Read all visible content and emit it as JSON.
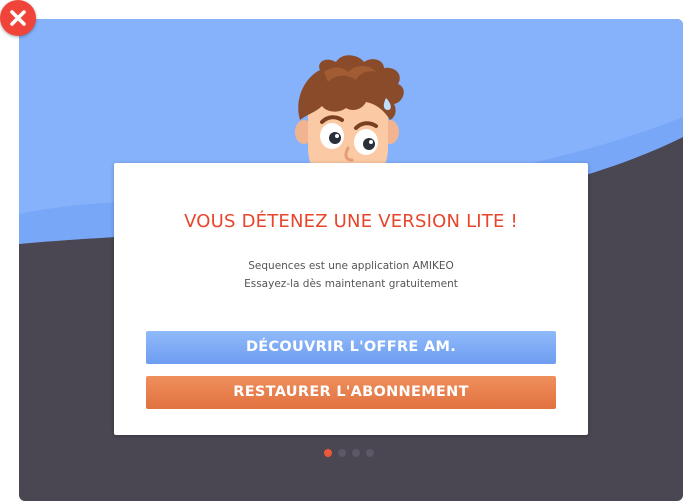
{
  "dialog": {
    "title": "VOUS DÉTENEZ UNE VERSION LITE !",
    "line1": "Sequences est une application AMIKEO",
    "line2": "Essayez-la dès maintenant gratuitement",
    "discover_label": "DÉCOUVRIR L'OFFRE AM.",
    "restore_label": "RESTAURER L'ABONNEMENT"
  },
  "pager": {
    "total": 4,
    "current": 1
  },
  "colors": {
    "title": "#e8452b",
    "discover_button": "#7aa8f5",
    "restore_button": "#e67c48",
    "background_dark": "#4a4652",
    "background_sky": "#86b2fb",
    "close_button": "#f0443a"
  },
  "icons": {
    "close": "close-icon",
    "mascot": "worried-boy-avatar"
  }
}
